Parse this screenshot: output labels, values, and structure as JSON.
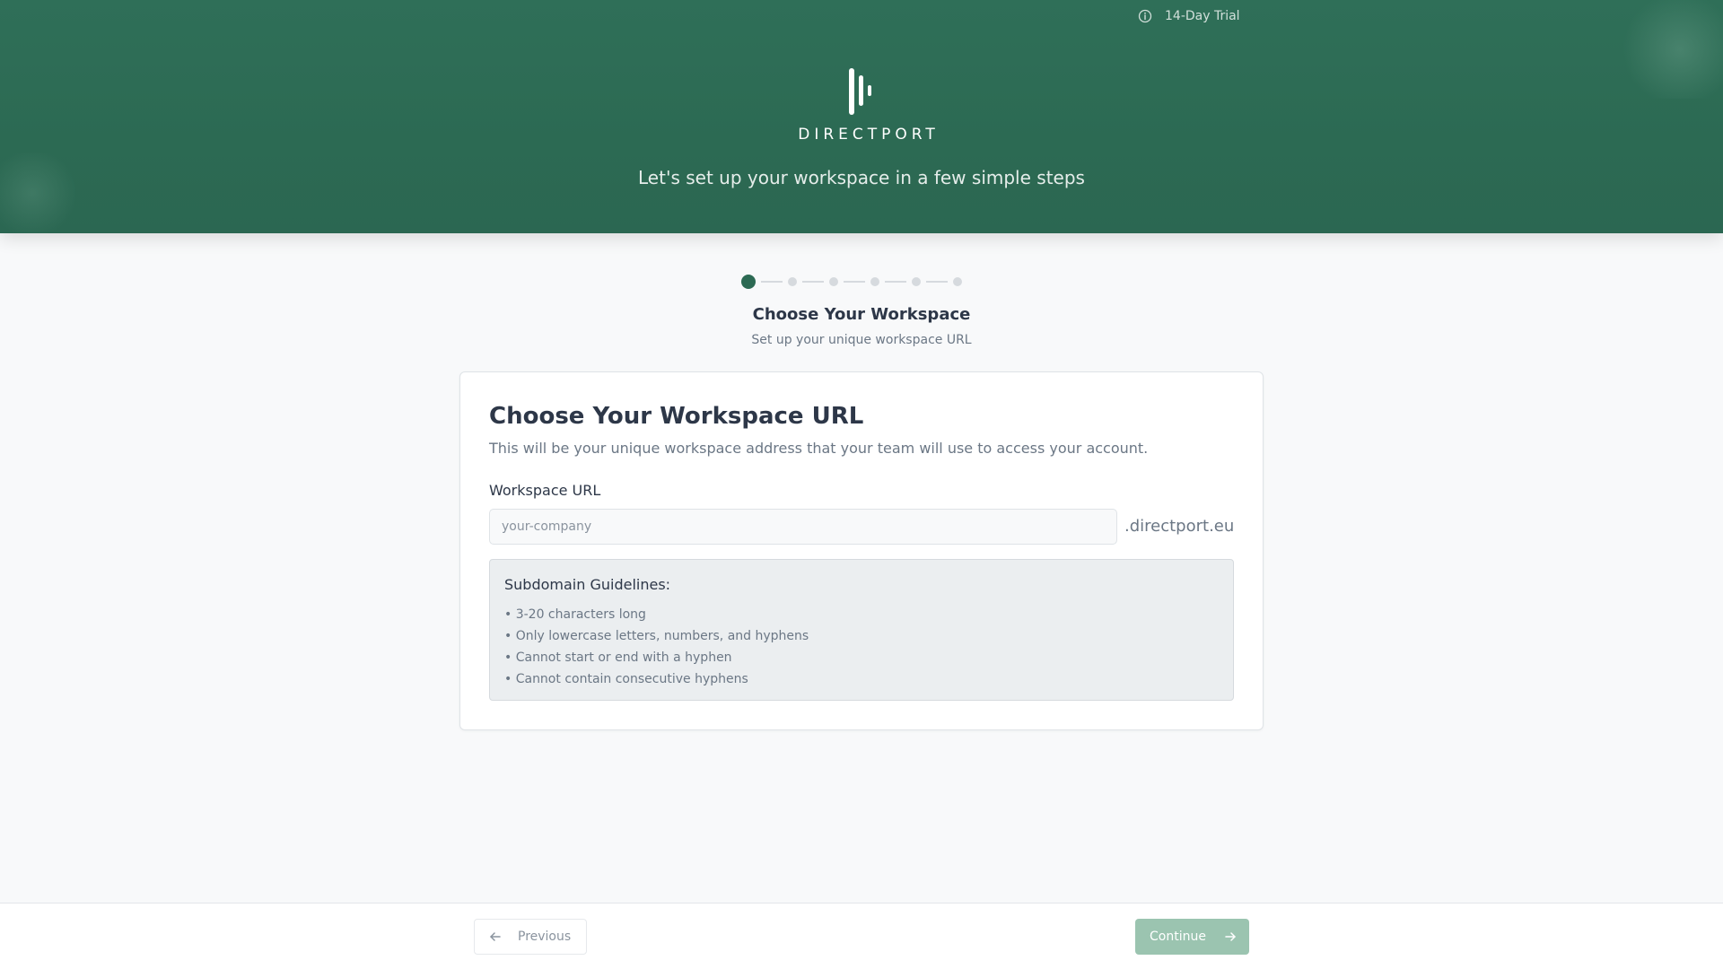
{
  "header": {
    "trial_label": "14-Day Trial",
    "brand_name": "DIRECTPORT",
    "tagline": "Let's set up your workspace in a few simple steps"
  },
  "stepper": {
    "current_step": 1,
    "total_steps": 6,
    "title": "Choose Your Workspace",
    "subtitle": "Set up your unique workspace URL"
  },
  "card": {
    "title": "Choose Your Workspace URL",
    "description": "This will be your unique workspace address that your team will use to access your account.",
    "field_label": "Workspace URL",
    "input_value": "",
    "input_placeholder": "your-company",
    "domain_suffix": ".directport.eu",
    "guidelines": {
      "title": "Subdomain Guidelines:",
      "items": [
        "• 3-20 characters long",
        "• Only lowercase letters, numbers, and hyphens",
        "• Cannot start or end with a hyphen",
        "• Cannot contain consecutive hyphens"
      ]
    }
  },
  "footer": {
    "previous_label": "Previous",
    "continue_label": "Continue"
  },
  "icons": {
    "trial": "info-circle-icon",
    "previous": "arrow-left-icon",
    "continue": "arrow-right-icon",
    "logo": "directport-logo"
  },
  "colors": {
    "brand": "#2c6a53",
    "continue_disabled": "#9bc4b0",
    "step_inactive": "#d6dade"
  }
}
